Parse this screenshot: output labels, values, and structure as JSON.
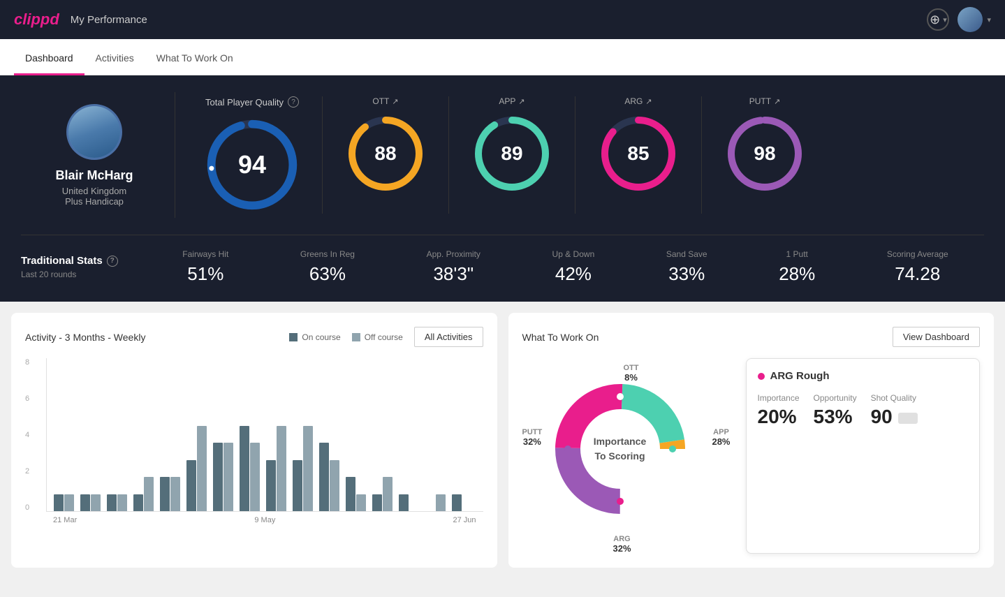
{
  "header": {
    "logo": "clippd",
    "title": "My Performance",
    "add_button_icon": "+",
    "chevron": "▾"
  },
  "nav": {
    "tabs": [
      {
        "label": "Dashboard",
        "active": true
      },
      {
        "label": "Activities",
        "active": false
      },
      {
        "label": "What To Work On",
        "active": false
      }
    ]
  },
  "player": {
    "name": "Blair McHarg",
    "country": "United Kingdom",
    "handicap": "Plus Handicap"
  },
  "quality": {
    "label": "Total Player Quality",
    "help": "?",
    "score": "94",
    "metrics": [
      {
        "key": "OTT",
        "value": "88",
        "color": "#f5a623",
        "arrow": "↗"
      },
      {
        "key": "APP",
        "value": "89",
        "color": "#4dd0b0",
        "arrow": "↗"
      },
      {
        "key": "ARG",
        "value": "85",
        "color": "#e91e8c",
        "arrow": "↗"
      },
      {
        "key": "PUTT",
        "value": "98",
        "color": "#9b59b6",
        "arrow": "↗"
      }
    ]
  },
  "traditional_stats": {
    "title": "Traditional Stats",
    "help": "?",
    "subtitle": "Last 20 rounds",
    "items": [
      {
        "label": "Fairways Hit",
        "value": "51%"
      },
      {
        "label": "Greens In Reg",
        "value": "63%"
      },
      {
        "label": "App. Proximity",
        "value": "38'3\""
      },
      {
        "label": "Up & Down",
        "value": "42%"
      },
      {
        "label": "Sand Save",
        "value": "33%"
      },
      {
        "label": "1 Putt",
        "value": "28%"
      },
      {
        "label": "Scoring Average",
        "value": "74.28"
      }
    ]
  },
  "activity_chart": {
    "title": "Activity - 3 Months - Weekly",
    "legend": [
      {
        "label": "On course",
        "color": "#546e7a"
      },
      {
        "label": "Off course",
        "color": "#90a4ae"
      }
    ],
    "all_activities_btn": "All Activities",
    "x_labels": [
      "21 Mar",
      "9 May",
      "27 Jun"
    ],
    "y_labels": [
      "8",
      "6",
      "4",
      "2",
      "0"
    ],
    "bars": [
      {
        "on": 1,
        "off": 1
      },
      {
        "on": 1,
        "off": 1
      },
      {
        "on": 1,
        "off": 1
      },
      {
        "on": 1,
        "off": 2
      },
      {
        "on": 2,
        "off": 2
      },
      {
        "on": 3,
        "off": 5
      },
      {
        "on": 4,
        "off": 4
      },
      {
        "on": 5,
        "off": 4
      },
      {
        "on": 3,
        "off": 5
      },
      {
        "on": 3,
        "off": 5
      },
      {
        "on": 4,
        "off": 3
      },
      {
        "on": 2,
        "off": 1
      },
      {
        "on": 1,
        "off": 2
      },
      {
        "on": 1,
        "off": 0
      },
      {
        "on": 0,
        "off": 1
      },
      {
        "on": 1,
        "off": 0
      }
    ]
  },
  "work_on": {
    "title": "What To Work On",
    "view_btn": "View Dashboard",
    "center_text_line1": "Importance",
    "center_text_line2": "To Scoring",
    "segments": [
      {
        "label": "OTT",
        "pct": "8%",
        "color": "#f5a623",
        "position": "top"
      },
      {
        "label": "APP",
        "pct": "28%",
        "color": "#4dd0b0",
        "position": "right"
      },
      {
        "label": "ARG",
        "pct": "32%",
        "color": "#e91e8c",
        "position": "bottom"
      },
      {
        "label": "PUTT",
        "pct": "32%",
        "color": "#9b59b6",
        "position": "left"
      }
    ],
    "highlight": {
      "title": "ARG Rough",
      "dot_color": "#e91e8c",
      "metrics": [
        {
          "label": "Importance",
          "value": "20%"
        },
        {
          "label": "Opportunity",
          "value": "53%"
        },
        {
          "label": "Shot Quality",
          "value": "90"
        }
      ]
    }
  }
}
